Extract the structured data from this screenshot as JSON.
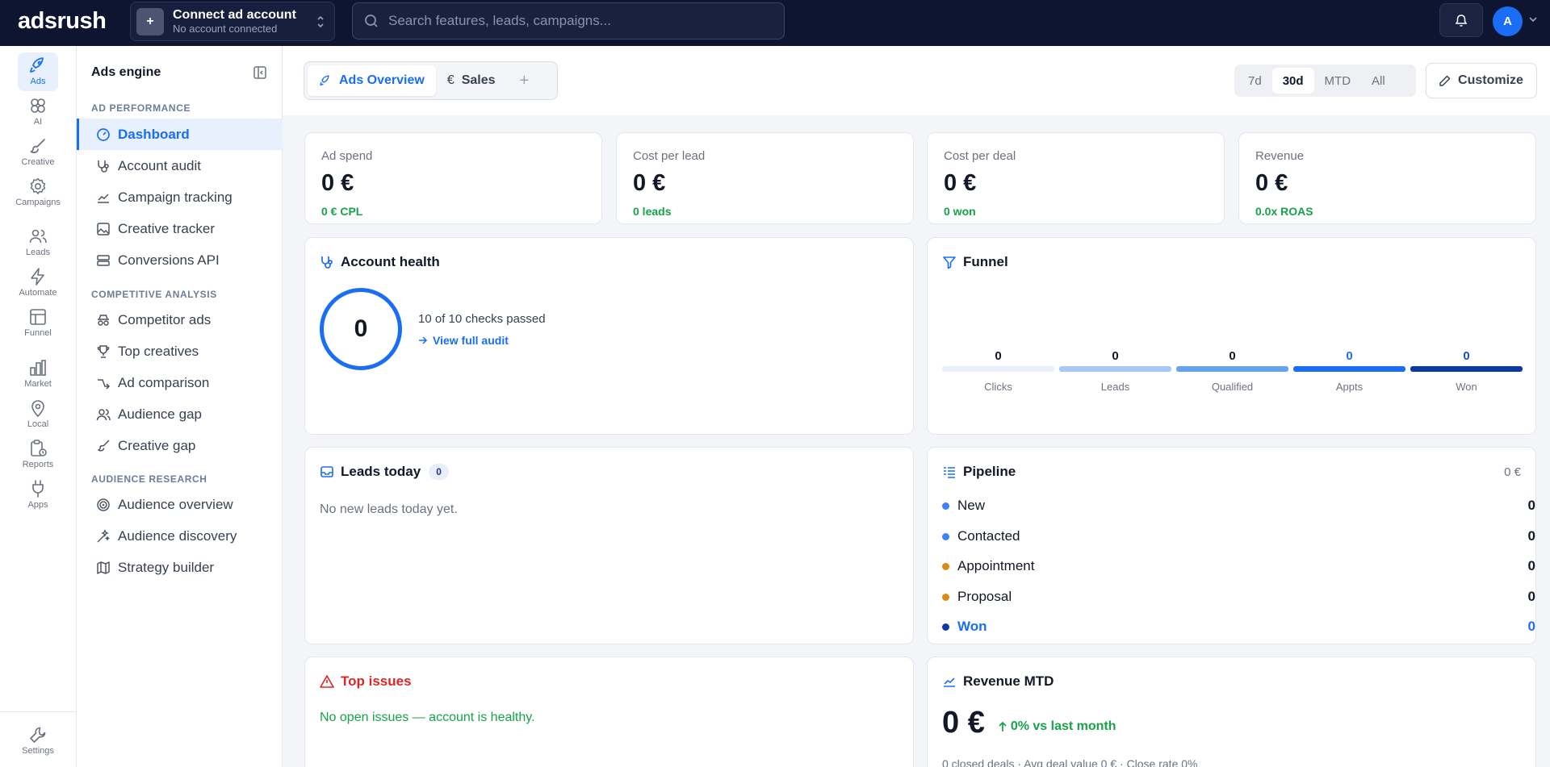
{
  "app": {
    "logo": "adsrush"
  },
  "topbar": {
    "connect_title": "Connect ad account",
    "connect_sub": "No account connected",
    "connect_plus": "+",
    "search_placeholder": "Search features, leads, campaigns...",
    "avatar_initial": "A"
  },
  "rail": {
    "items": [
      {
        "label": "Ads",
        "icon": "rocket-icon"
      },
      {
        "label": "AI",
        "icon": "brain-icon"
      },
      {
        "label": "Creative",
        "icon": "brush-icon"
      },
      {
        "label": "Campaigns",
        "icon": "gear-icon"
      },
      {
        "label": "Leads",
        "icon": "users-icon"
      },
      {
        "label": "Automate",
        "icon": "bolt-icon"
      },
      {
        "label": "Funnel",
        "icon": "window-icon"
      },
      {
        "label": "Market",
        "icon": "bar-chart-icon"
      },
      {
        "label": "Local",
        "icon": "map-pin-icon"
      },
      {
        "label": "Reports",
        "icon": "clipboard-clock-icon"
      },
      {
        "label": "Apps",
        "icon": "plug-icon"
      }
    ],
    "settings": "Settings"
  },
  "sidebar": {
    "title": "Ads engine",
    "sections": [
      {
        "title": "AD PERFORMANCE",
        "items": [
          "Dashboard",
          "Account audit",
          "Campaign tracking",
          "Creative tracker",
          "Conversions API"
        ]
      },
      {
        "title": "COMPETITIVE ANALYSIS",
        "items": [
          "Competitor ads",
          "Top creatives",
          "Ad comparison",
          "Audience gap",
          "Creative gap"
        ]
      },
      {
        "title": "AUDIENCE RESEARCH",
        "items": [
          "Audience overview",
          "Audience discovery",
          "Strategy builder"
        ]
      }
    ]
  },
  "header": {
    "tabs": [
      {
        "label": "Ads Overview"
      },
      {
        "label": "Sales",
        "symbol": "€"
      }
    ],
    "add_tab": "+",
    "ranges": [
      "7d",
      "30d",
      "MTD",
      "All"
    ],
    "active_range": "30d",
    "customize": "Customize"
  },
  "kpis": [
    {
      "label": "Ad spend",
      "value": "0 €",
      "sub": "0 € CPL"
    },
    {
      "label": "Cost per lead",
      "value": "0 €",
      "sub": "0 leads"
    },
    {
      "label": "Cost per deal",
      "value": "0 €",
      "sub": "0 won"
    },
    {
      "label": "Revenue",
      "value": "0 €",
      "sub": "0.0x ROAS"
    }
  ],
  "health": {
    "title": "Account health",
    "score": "0",
    "checks": "10 of 10 checks passed",
    "link": "View full audit"
  },
  "funnel": {
    "title": "Funnel",
    "stages": [
      {
        "label": "Clicks",
        "value": "0",
        "color": "#e8eefb",
        "value_color": "#111827"
      },
      {
        "label": "Leads",
        "value": "0",
        "color": "#a7c8f5",
        "value_color": "#111827"
      },
      {
        "label": "Qualified",
        "value": "0",
        "color": "#66a3ef",
        "value_color": "#111827"
      },
      {
        "label": "Appts",
        "value": "0",
        "color": "#1a6ef5",
        "value_color": "#1a6ef5"
      },
      {
        "label": "Won",
        "value": "0",
        "color": "#0b3aa3",
        "value_color": "#1a4fc4"
      }
    ]
  },
  "leads_today": {
    "title": "Leads today",
    "count": "0",
    "empty": "No new leads today yet."
  },
  "pipeline": {
    "title": "Pipeline",
    "total": "0 €",
    "rows": [
      {
        "label": "New",
        "value": "0",
        "color": "#3b82f6"
      },
      {
        "label": "Contacted",
        "value": "0",
        "color": "#3b82f6"
      },
      {
        "label": "Appointment",
        "value": "0",
        "color": "#d98b1a"
      },
      {
        "label": "Proposal",
        "value": "0",
        "color": "#d98b1a"
      },
      {
        "label": "Won",
        "value": "0",
        "color": "#0b3aa3"
      }
    ]
  },
  "issues": {
    "title": "Top issues",
    "ok": "No open issues — account is healthy."
  },
  "revenue_mtd": {
    "title": "Revenue MTD",
    "value": "0 €",
    "delta": "0% vs last month",
    "footer": "0 closed deals · Avg deal value 0 € · Close rate 0%"
  },
  "colors": {
    "accent": "#1a6ef5",
    "topbar": "#0e1530",
    "positive": "#16a34a",
    "danger": "#dc2626"
  }
}
